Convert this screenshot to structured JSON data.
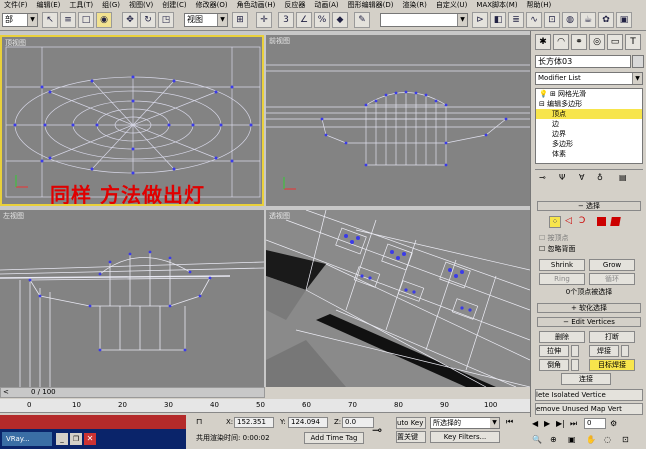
{
  "menu": [
    "文件(F)",
    "编辑(E)",
    "工具(T)",
    "组(G)",
    "视图(V)",
    "创建(C)",
    "修改器(O)",
    "角色动画(H)",
    "反应器",
    "动画(A)",
    "图形编辑器(D)",
    "渲染(R)",
    "自定义(U)",
    "MAX脚本(M)",
    "帮助(H)"
  ],
  "toolbar": {
    "selection_filter": "部",
    "view_combo": "视图",
    "named_selection": ""
  },
  "viewports": {
    "top": "顶视图",
    "front": "前视图",
    "left": "左视图",
    "persp": "透视图"
  },
  "annotation": "同样 方法做出灯",
  "panel": {
    "object_name": "长方体03",
    "modifier_list": "Modifier List",
    "stack": [
      "网格光滑",
      "编辑多边形",
      "顶点",
      "边",
      "边界",
      "多边形",
      "体素"
    ],
    "rollout_select": "选择",
    "by_vertex": "按顶点",
    "ignore_backface": "忽略背面",
    "shrink": "Shrink",
    "grow": "Grow",
    "ring": "Ring",
    "loop": "循环",
    "sel_info": "0个顶点被选择",
    "soft_sel": "软化选择",
    "edit_vertices": "Edit Vertices",
    "remove": "删除",
    "break": "打断",
    "extrude": "拉伸",
    "weld": "焊接",
    "chamfer": "倒角",
    "target_weld": "目标焊接",
    "connect": "连接",
    "remove_isolated": "lete Isolated Vertice",
    "remove_unused": "emove Unused Map Vert"
  },
  "timeline": {
    "frame": "0 / 100",
    "ticks": [
      "0",
      "10",
      "20",
      "30",
      "40",
      "50",
      "60",
      "70",
      "80",
      "90",
      "100"
    ]
  },
  "status": {
    "x_label": "X:",
    "x": "152.351",
    "y_label": "Y:",
    "y": "124.094",
    "z_label": "Z:",
    "z": "0.0",
    "render_time": "共用渲染时间:  0:00:02",
    "add_time_tag": "Add Time Tag",
    "auto_key": "uto Key",
    "set_key": "置关键",
    "selected": "所选择的",
    "key_filters": "Key Filters...",
    "frame_field": "0"
  },
  "taskbar": {
    "app": "VRay..."
  }
}
